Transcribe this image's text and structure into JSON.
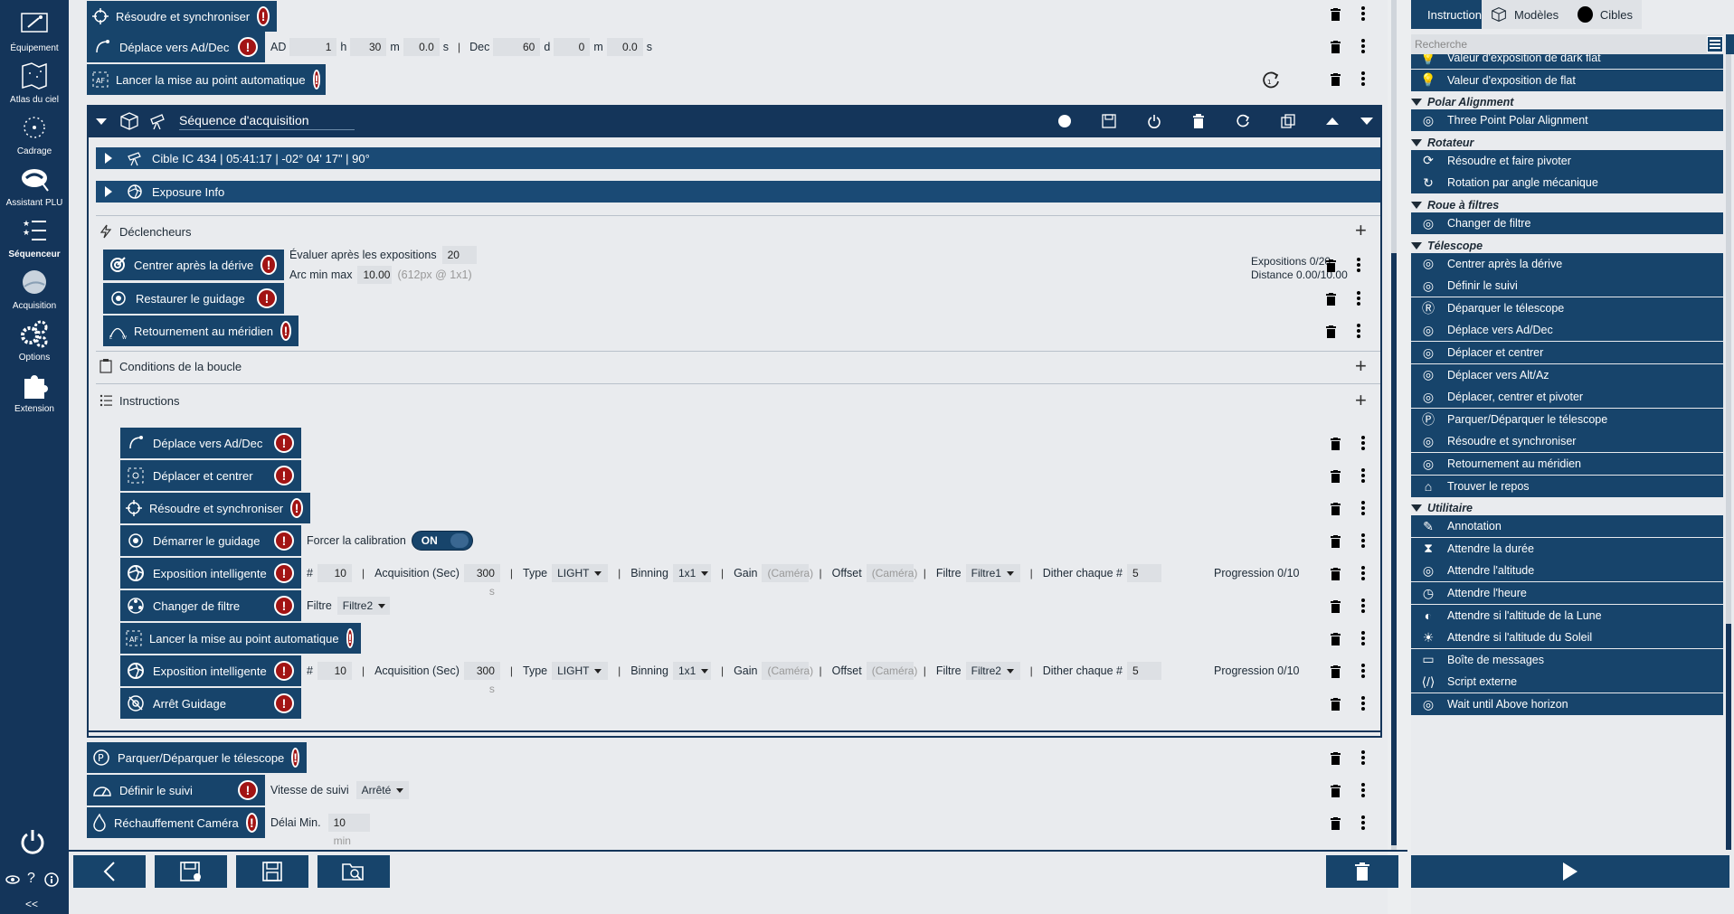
{
  "nav": {
    "items": [
      {
        "label": "Équipement",
        "icon": "equipment-icon"
      },
      {
        "label": "Atlas du ciel",
        "icon": "sky-atlas-icon"
      },
      {
        "label": "Cadrage",
        "icon": "framing-icon"
      },
      {
        "label": "Assistant PLU",
        "icon": "flat-wizard-icon"
      },
      {
        "label": "Séquenceur",
        "icon": "sequencer-icon"
      },
      {
        "label": "Acquisition",
        "icon": "imaging-icon"
      },
      {
        "label": "Options",
        "icon": "gears-icon"
      },
      {
        "label": "Extension",
        "icon": "plugin-icon"
      }
    ],
    "collapse": "<<"
  },
  "top_instructions": [
    {
      "label": "Résoudre et synchroniser"
    },
    {
      "label": "Déplace vers Ad/Dec",
      "ad_label": "AD",
      "ad_h": "1",
      "ad_h_unit": "h",
      "ad_m": "30",
      "ad_m_unit": "m",
      "ad_s": "0.0",
      "ad_s_unit": "s",
      "dec_label": "Dec",
      "dec_d": "60",
      "dec_d_unit": "d",
      "dec_m": "0",
      "dec_m_unit": "m",
      "dec_s": "0.0",
      "dec_s_unit": "s"
    },
    {
      "label": "Lancer la mise au point automatique"
    }
  ],
  "sequence": {
    "title": "Séquence d'acquisition",
    "target_row": "Cible  IC 434 | 05:41:17 | -02° 04' 17\" | 90°",
    "exposure_info": "Exposure Info",
    "triggers_title": "Déclencheurs",
    "triggers": [
      {
        "label": "Centrer après la dérive",
        "eval_label": "Évaluer après les expositions",
        "eval_value": "20",
        "arcmin_label": "Arc min max",
        "arcmin_value": "10.00",
        "arcmin_hint": "(612px @ 1x1)",
        "status1": "Expositions  0/20",
        "status2": "Distance  0.00/10.00"
      },
      {
        "label": "Restaurer le guidage"
      },
      {
        "label": "Retournement au méridien"
      }
    ],
    "loop_title": "Conditions de la boucle",
    "instructions_title": "Instructions",
    "instructions": [
      {
        "label": "Déplace vers Ad/Dec"
      },
      {
        "label": "Déplacer et centrer"
      },
      {
        "label": "Résoudre et synchroniser"
      },
      {
        "label": "Démarrer le guidage",
        "force_label": "Forcer la calibration",
        "toggle": "ON"
      },
      {
        "label": "Exposition intelligente",
        "count_label": "#",
        "count": "10",
        "acq_label": "Acquisition (Sec)",
        "acq": "300",
        "acq_unit": "s",
        "type_label": "Type",
        "type": "LIGHT",
        "bin_label": "Binning",
        "bin": "1x1",
        "gain_label": "Gain",
        "gain": "(Caméra)",
        "offset_label": "Offset",
        "offset": "(Caméra)",
        "filter_label": "Filtre",
        "filter": "Filtre1",
        "dither_label": "Dither chaque #",
        "dither": "5",
        "progress": "Progression  0/10"
      },
      {
        "label": "Changer de filtre",
        "filter_label": "Filtre",
        "filter": "Filtre2"
      },
      {
        "label": "Lancer la mise au point automatique"
      },
      {
        "label": "Exposition intelligente",
        "count_label": "#",
        "count": "10",
        "acq_label": "Acquisition (Sec)",
        "acq": "300",
        "acq_unit": "s",
        "type_label": "Type",
        "type": "LIGHT",
        "bin_label": "Binning",
        "bin": "1x1",
        "gain_label": "Gain",
        "gain": "(Caméra)",
        "offset_label": "Offset",
        "offset": "(Caméra)",
        "filter_label": "Filtre",
        "filter": "Filtre2",
        "dither_label": "Dither chaque #",
        "dither": "5",
        "progress": "Progression  0/10"
      },
      {
        "label": "Arrêt Guidage"
      }
    ]
  },
  "bottom_instructions": [
    {
      "label": "Parquer/Déparquer le télescope"
    },
    {
      "label": "Définir le suivi",
      "speed_label": "Vitesse de suivi",
      "speed": "Arrêté"
    },
    {
      "label": "Réchauffement Caméra",
      "delay_label": "Délai Min.",
      "delay": "10",
      "delay_unit": "min"
    }
  ],
  "right": {
    "tabs": [
      "Instructions",
      "Modèles",
      "Cibles"
    ],
    "search_placeholder": "Recherche",
    "items": [
      {
        "type": "item",
        "label": "Valeur d'exposition de dark flat"
      },
      {
        "type": "item",
        "label": "Valeur d'exposition de flat"
      },
      {
        "type": "cat",
        "label": "Polar Alignment"
      },
      {
        "type": "item",
        "label": "Three Point Polar Alignment"
      },
      {
        "type": "cat",
        "label": "Rotateur"
      },
      {
        "type": "item",
        "label": "Résoudre et faire pivoter"
      },
      {
        "type": "item",
        "label": "Rotation par angle mécanique"
      },
      {
        "type": "cat",
        "label": "Roue à filtres"
      },
      {
        "type": "item",
        "label": "Changer de filtre"
      },
      {
        "type": "cat",
        "label": "Télescope"
      },
      {
        "type": "item",
        "label": "Centrer après la dérive"
      },
      {
        "type": "item",
        "label": "Définir le suivi"
      },
      {
        "type": "item",
        "label": "Déparquer le télescope"
      },
      {
        "type": "item",
        "label": "Déplace vers Ad/Dec"
      },
      {
        "type": "item",
        "label": "Déplacer et centrer"
      },
      {
        "type": "item",
        "label": "Déplacer vers Alt/Az"
      },
      {
        "type": "item",
        "label": "Déplacer, centrer et pivoter"
      },
      {
        "type": "item",
        "label": "Parquer/Déparquer le télescope"
      },
      {
        "type": "item",
        "label": "Résoudre et synchroniser"
      },
      {
        "type": "item",
        "label": "Retournement au méridien"
      },
      {
        "type": "item",
        "label": "Trouver le repos"
      },
      {
        "type": "cat",
        "label": "Utilitaire"
      },
      {
        "type": "item",
        "label": "Annotation"
      },
      {
        "type": "item",
        "label": "Attendre la durée"
      },
      {
        "type": "item",
        "label": "Attendre l'altitude"
      },
      {
        "type": "item",
        "label": "Attendre l'heure"
      },
      {
        "type": "item",
        "label": "Attendre si l'altitude de la Lune"
      },
      {
        "type": "item",
        "label": "Attendre si l'altitude du Soleil"
      },
      {
        "type": "item",
        "label": "Boîte de messages"
      },
      {
        "type": "item",
        "label": "Script externe"
      },
      {
        "type": "item",
        "label": "Wait until Above horizon"
      }
    ]
  },
  "colors": {
    "nav": "#14355a",
    "block": "#17446b",
    "warn": "#a21414",
    "bg": "#e9ebee"
  }
}
